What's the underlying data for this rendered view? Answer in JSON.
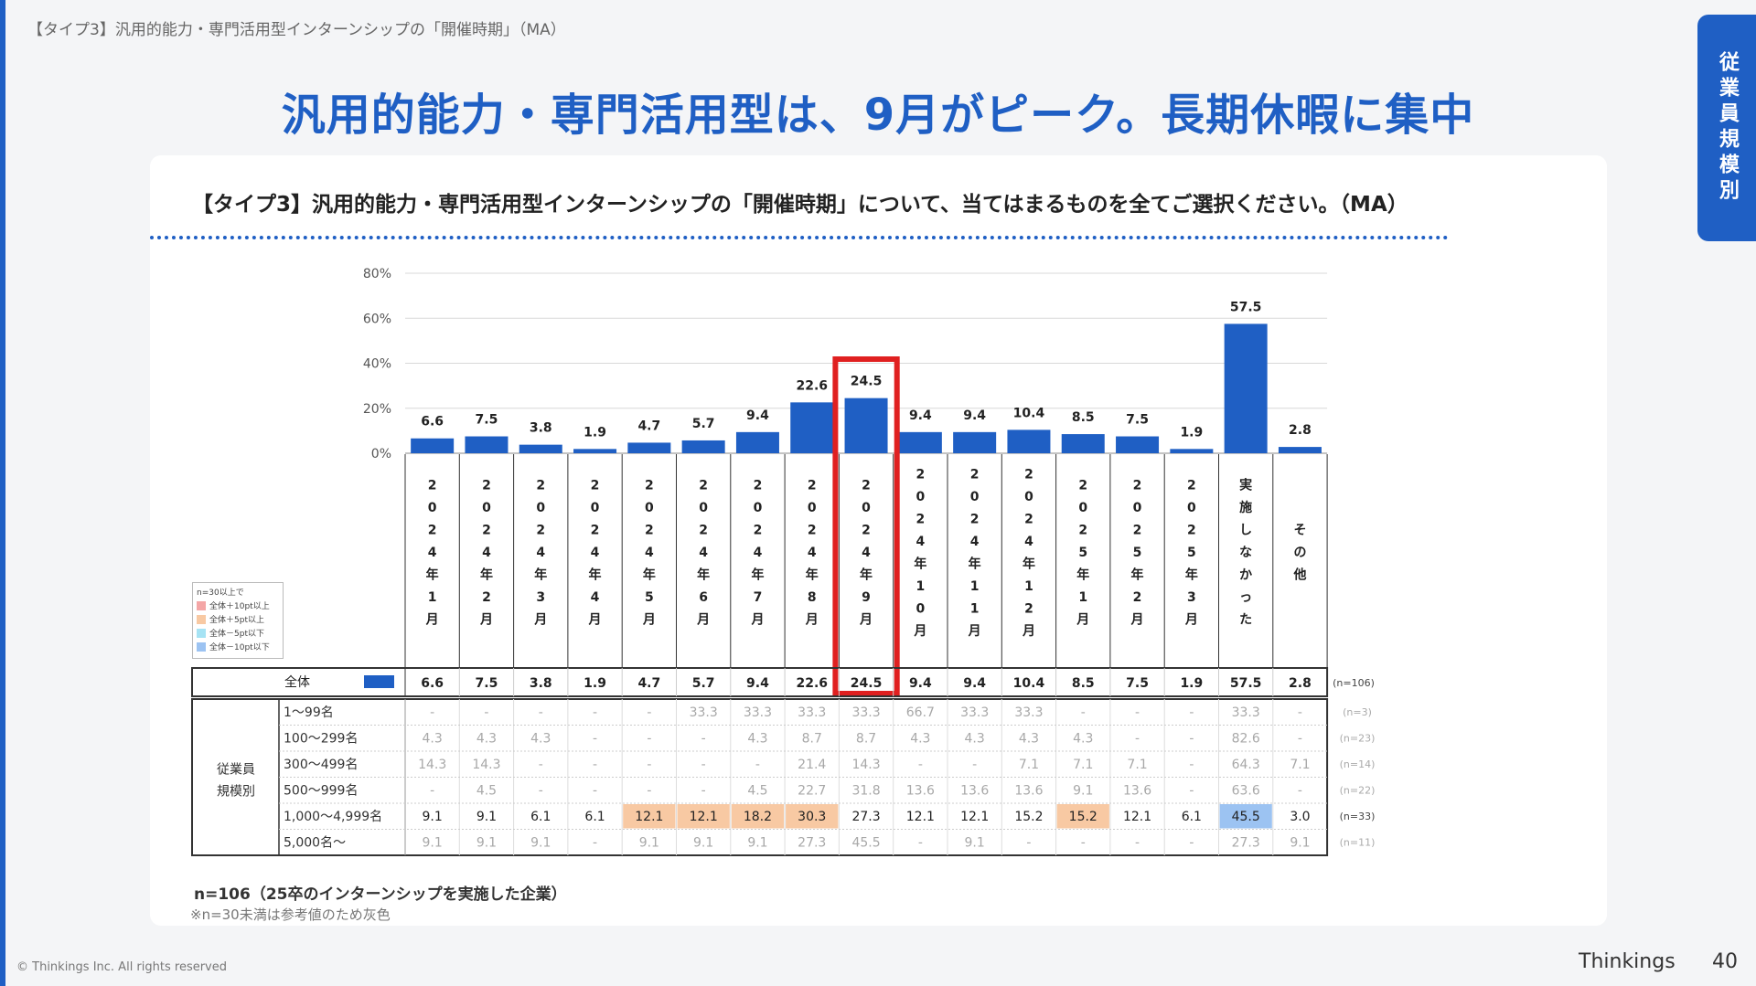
{
  "header": {
    "small_title": "【タイプ3】汎用的能力・専門活用型インターンシップの「開催時期」（MA）",
    "headline": "汎用的能力・専門活用型は、9月がピーク。長期休暇に集中",
    "side_tab": "従業員規模別"
  },
  "question": "【タイプ3】汎用的能力・専門活用型インターンシップの「開催時期」について、当てはまるものを全てご選択ください。（MA）",
  "legend": {
    "title": "n=30以上で",
    "items": [
      {
        "label": "全体＋10pt以上",
        "color": "#f4a6a6"
      },
      {
        "label": "全体＋5pt以上",
        "color": "#f8c9a3"
      },
      {
        "label": "全体－5pt以下",
        "color": "#a6e3f4"
      },
      {
        "label": "全体－10pt以下",
        "color": "#9cc3f2"
      }
    ]
  },
  "chart_data": {
    "type": "bar",
    "ylim": [
      0,
      80
    ],
    "yticks": [
      "0%",
      "20%",
      "40%",
      "60%",
      "80%"
    ],
    "categories": [
      "2024年1月",
      "2024年2月",
      "2024年3月",
      "2024年4月",
      "2024年5月",
      "2024年6月",
      "2024年7月",
      "2024年8月",
      "2024年9月",
      "2024年10月",
      "2024年11月",
      "2024年12月",
      "2025年1月",
      "2025年2月",
      "2025年3月",
      "実施しなかった",
      "その他"
    ],
    "values": [
      6.6,
      7.5,
      3.8,
      1.9,
      4.7,
      5.7,
      9.4,
      22.6,
      24.5,
      9.4,
      9.4,
      10.4,
      8.5,
      7.5,
      1.9,
      57.5,
      2.8
    ],
    "labels": [
      "6.6",
      "7.5",
      "3.8",
      "1.9",
      "4.7",
      "5.7",
      "9.4",
      "22.6",
      "24.5",
      "9.4",
      "9.4",
      "10.4",
      "8.5",
      "7.5",
      "1.9",
      "57.5",
      "2.8"
    ],
    "bar_color": "#1f5fc4",
    "highlight_category": "2024年9月",
    "highlight_color": "#e02020"
  },
  "table": {
    "total_row": {
      "label": "全体",
      "values": [
        "6.6",
        "7.5",
        "3.8",
        "1.9",
        "4.7",
        "5.7",
        "9.4",
        "22.6",
        "24.5",
        "9.4",
        "9.4",
        "10.4",
        "8.5",
        "7.5",
        "1.9",
        "57.5",
        "2.8"
      ],
      "n": "(n=106)"
    },
    "group_label": [
      "従業員",
      "規模別"
    ],
    "rows": [
      {
        "label": "1～99名",
        "n": "(n=3)",
        "grey": true,
        "values": [
          "-",
          "-",
          "-",
          "-",
          "-",
          "33.3",
          "33.3",
          "33.3",
          "33.3",
          "66.7",
          "33.3",
          "33.3",
          "-",
          "-",
          "-",
          "33.3",
          "-"
        ],
        "hl": []
      },
      {
        "label": "100～299名",
        "n": "(n=23)",
        "grey": true,
        "values": [
          "4.3",
          "4.3",
          "4.3",
          "-",
          "-",
          "-",
          "4.3",
          "8.7",
          "8.7",
          "4.3",
          "4.3",
          "4.3",
          "4.3",
          "-",
          "-",
          "82.6",
          "-"
        ],
        "hl": []
      },
      {
        "label": "300～499名",
        "n": "(n=14)",
        "grey": true,
        "values": [
          "14.3",
          "14.3",
          "-",
          "-",
          "-",
          "-",
          "-",
          "21.4",
          "14.3",
          "-",
          "-",
          "7.1",
          "7.1",
          "7.1",
          "-",
          "64.3",
          "7.1"
        ],
        "hl": []
      },
      {
        "label": "500～999名",
        "n": "(n=22)",
        "grey": true,
        "values": [
          "-",
          "4.5",
          "-",
          "-",
          "-",
          "-",
          "4.5",
          "22.7",
          "31.8",
          "13.6",
          "13.6",
          "13.6",
          "9.1",
          "13.6",
          "-",
          "63.6",
          "-"
        ],
        "hl": []
      },
      {
        "label": "1,000～4,999名",
        "n": "(n=33)",
        "grey": false,
        "values": [
          "9.1",
          "9.1",
          "6.1",
          "6.1",
          "12.1",
          "12.1",
          "18.2",
          "30.3",
          "27.3",
          "12.1",
          "12.1",
          "15.2",
          "15.2",
          "12.1",
          "6.1",
          "45.5",
          "3.0"
        ],
        "hl": [
          "",
          "",
          "",
          "",
          "#f8c9a3",
          "#f8c9a3",
          "#f8c9a3",
          "#f8c9a3",
          "",
          "",
          "",
          "",
          "#f8c9a3",
          "",
          "",
          "#9cc3f2",
          ""
        ]
      },
      {
        "label": "5,000名～",
        "n": "(n=11)",
        "grey": true,
        "values": [
          "9.1",
          "9.1",
          "9.1",
          "-",
          "9.1",
          "9.1",
          "9.1",
          "27.3",
          "45.5",
          "-",
          "9.1",
          "-",
          "-",
          "-",
          "-",
          "27.3",
          "9.1"
        ],
        "hl": []
      }
    ]
  },
  "footnote": {
    "n": "n=106（25卒のインターンシップを実施した企業）",
    "note": "※n=30未満は参考値のため灰色"
  },
  "footer": {
    "copyright": "© Thinkings Inc. All rights reserved",
    "brand": "Thinkings",
    "page": "40"
  }
}
